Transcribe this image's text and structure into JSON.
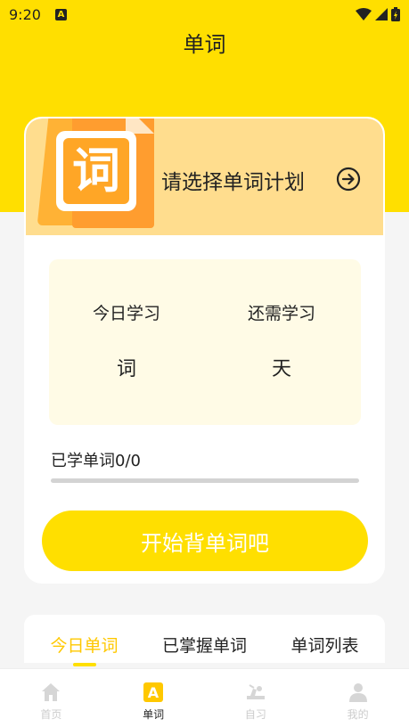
{
  "status_bar": {
    "time": "9:20",
    "notification_icon": "A"
  },
  "header": {
    "title": "单词"
  },
  "plan": {
    "label": "请选择单词计划",
    "icon_char": "词",
    "icon": "arrow-right-circle-icon"
  },
  "stats": {
    "today": {
      "label": "今日学习",
      "unit": "词"
    },
    "remaining": {
      "label": "还需学习",
      "unit": "天"
    }
  },
  "progress": {
    "label": "已学单词0/0",
    "fraction": 0
  },
  "start_button": {
    "label": "开始背单词吧"
  },
  "tabs": [
    {
      "label": "今日单词",
      "active": true
    },
    {
      "label": "已掌握单词",
      "active": false
    },
    {
      "label": "单词列表",
      "active": false
    }
  ],
  "bottom_nav": [
    {
      "label": "首页",
      "icon": "home-icon",
      "active": false
    },
    {
      "label": "单词",
      "icon": "letter-a-icon",
      "active": true
    },
    {
      "label": "自习",
      "icon": "study-desk-icon",
      "active": false
    },
    {
      "label": "我的",
      "icon": "person-icon",
      "active": false
    }
  ],
  "colors": {
    "accent": "#ffdf00",
    "plan_bg": "#ffdd8e",
    "stats_bg": "#fffbe6",
    "active_tab": "#ffc800"
  }
}
